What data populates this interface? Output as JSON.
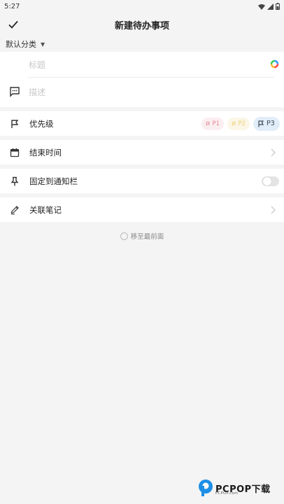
{
  "status_bar": {
    "time": "5:27"
  },
  "app_bar": {
    "title": "新建待办事项"
  },
  "category": {
    "selected": "默认分类"
  },
  "inputs": {
    "title_placeholder": "标题",
    "desc_placeholder": "描述"
  },
  "priority": {
    "label": "优先级",
    "chips": [
      {
        "label": "P1",
        "color": "#e58a98"
      },
      {
        "label": "P2",
        "color": "#ecd27a"
      },
      {
        "label": "P3",
        "color": "#3d4d5c"
      }
    ],
    "selected": "P3"
  },
  "end_time": {
    "label": "结束时间"
  },
  "pin": {
    "label": "固定到通知栏",
    "enabled": false
  },
  "linked_note": {
    "label": "关联笔记"
  },
  "move_top": {
    "label": "移至最前面"
  },
  "watermark": {
    "text": "PCPOP下载",
    "sub": "PCPOP.com"
  },
  "icons": {
    "confirm": "check-icon",
    "palette": "color-palette-icon",
    "description": "message-icon",
    "priority": "flag-icon",
    "calendar": "calendar-icon",
    "pin": "pin-icon",
    "link": "pencil-icon"
  }
}
